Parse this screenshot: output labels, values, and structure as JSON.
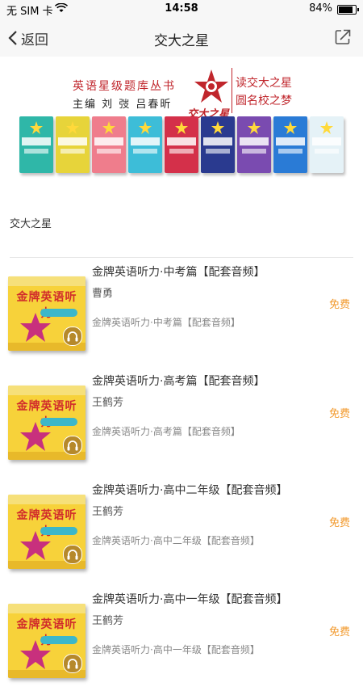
{
  "status": {
    "carrier": "无 SIM 卡",
    "time": "14:58",
    "battery": "84%",
    "battery_level": 0.84
  },
  "nav": {
    "back_label": "返回",
    "title": "交大之星"
  },
  "banner": {
    "series": "英语星级题库丛书",
    "editors": "主编  刘  弢   吕春昕",
    "logo_text": "交大之星",
    "slogan_line1": "读交大之星",
    "slogan_line2": "圆名校之梦",
    "book_colors": [
      "#2fb7a8",
      "#e7d43a",
      "#ef7d8c",
      "#3dbdd8",
      "#d4304a",
      "#2a3a8f",
      "#7a4bb0",
      "#2a7bd6",
      "#e5f2f7"
    ]
  },
  "section": {
    "title": "交大之星"
  },
  "items": [
    {
      "title": "金牌英语听力·中考篇【配套音频】",
      "author": "曹勇",
      "desc": "金牌英语听力·中考篇【配套音频】",
      "price": "免费",
      "cover_brand": "金牌英语听力"
    },
    {
      "title": "金牌英语听力·高考篇【配套音频】",
      "author": "王鹤芳",
      "desc": "金牌英语听力·高考篇【配套音频】",
      "price": "免费",
      "cover_brand": "金牌英语听力"
    },
    {
      "title": "金牌英语听力·高中二年级【配套音频】",
      "author": "王鹤芳",
      "desc": "金牌英语听力·高中二年级【配套音频】",
      "price": "免费",
      "cover_brand": "金牌英语听力"
    },
    {
      "title": "金牌英语听力·高中一年级【配套音频】",
      "author": "王鹤芳",
      "desc": "金牌英语听力·高中一年级【配套音频】",
      "price": "免费",
      "cover_brand": "金牌英语听力"
    }
  ],
  "colors": {
    "accent": "#f29a2e",
    "brand_red": "#c0262c",
    "cover_yellow": "#f7d23a"
  }
}
